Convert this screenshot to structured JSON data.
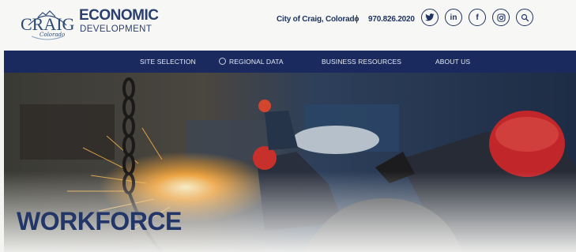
{
  "header": {
    "logo": {
      "craig": "CRAIG",
      "colorado": "Colorado",
      "economic": "ECONOMIC",
      "development": "DEVELOPMENT"
    },
    "city": "City of Craig, Colorado",
    "separator": "|",
    "phone": "970.826.2020",
    "socials": [
      {
        "name": "twitter",
        "icon": "twitter-icon"
      },
      {
        "name": "linkedin",
        "icon": "linkedin-icon",
        "glyph": "in"
      },
      {
        "name": "facebook",
        "icon": "facebook-icon",
        "glyph": "f"
      },
      {
        "name": "instagram",
        "icon": "instagram-icon"
      },
      {
        "name": "search",
        "icon": "search-icon"
      }
    ]
  },
  "nav": {
    "items": [
      {
        "label": "SITE SELECTION"
      },
      {
        "label": "REGIONAL DATA",
        "icon": "loading-icon"
      },
      {
        "label": "BUSINESS RESOURCES"
      },
      {
        "label": "ABOUT US"
      }
    ]
  },
  "hero": {
    "title": "WORKFORCE"
  },
  "colors": {
    "brand_navy": "#1a2a5e",
    "logo_blue": "#2b3f6e",
    "hero_title": "#233668"
  }
}
